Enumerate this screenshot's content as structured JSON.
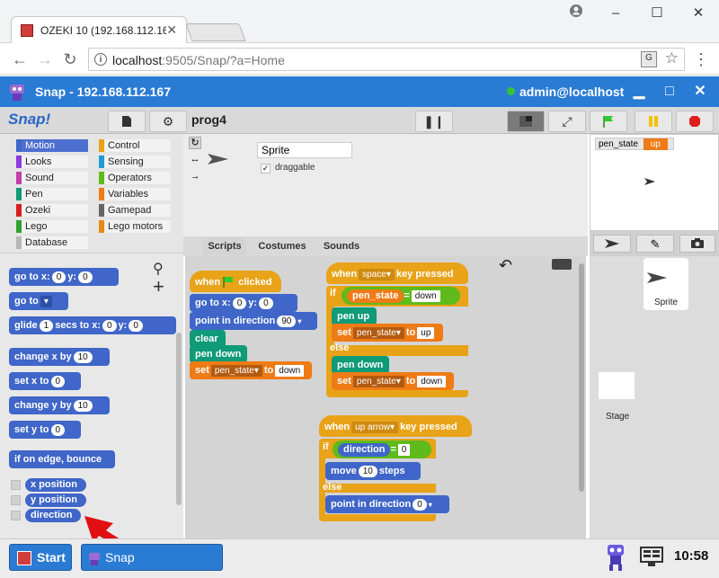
{
  "browser": {
    "tab_title": "OZEKI 10 (192.168.112.16",
    "url_host": "localhost",
    "url_rest": ":9505/Snap/?a=Home",
    "minimize": "–",
    "maximize": "☐",
    "close": "✕",
    "back": "←",
    "forward": "→",
    "reload": "↻"
  },
  "ozeki": {
    "title": "Snap - 192.168.112.167",
    "user": "admin@localhost",
    "minimize": "▁",
    "maximize": "□",
    "close": "✕"
  },
  "snap": {
    "logo": "Snap!",
    "project": "prog4",
    "categories": [
      {
        "label": "Motion",
        "color": "#3f66c8"
      },
      {
        "label": "Control",
        "color": "#e8a318"
      },
      {
        "label": "Looks",
        "color": "#8c3ce0"
      },
      {
        "label": "Sensing",
        "color": "#1f9ad6"
      },
      {
        "label": "Sound",
        "color": "#c43fa8"
      },
      {
        "label": "Operators",
        "color": "#5fbb1b"
      },
      {
        "label": "Pen",
        "color": "#0f9a78"
      },
      {
        "label": "Variables",
        "color": "#ef7b16"
      },
      {
        "label": "Ozeki",
        "color": "#d62020"
      },
      {
        "label": "Gamepad",
        "color": "#666666"
      },
      {
        "label": "Lego",
        "color": "#2fa22f"
      },
      {
        "label": "Lego motors",
        "color": "#e88a10"
      },
      {
        "label": "Database",
        "color": "#b8b8b8"
      }
    ],
    "palette": {
      "goto_xy": {
        "label": "go to x:",
        "x": "0",
        "y_label": "y:",
        "y": "0"
      },
      "goto": {
        "label": "go to"
      },
      "glide": {
        "label": "glide",
        "secs": "1",
        "secs_label": "secs to x:",
        "x": "0",
        "y_label": "y:",
        "y": "0"
      },
      "change_x": {
        "label": "change x by",
        "value": "10"
      },
      "set_x": {
        "label": "set x to",
        "value": "0"
      },
      "change_y": {
        "label": "change y by",
        "value": "10"
      },
      "set_y": {
        "label": "set y to",
        "value": "0"
      },
      "bounce": "if on edge, bounce",
      "x_position": "x position",
      "y_position": "y position",
      "direction": "direction"
    },
    "sprite": {
      "name": "Sprite",
      "draggable_label": "draggable"
    },
    "tabs": [
      "Scripts",
      "Costumes",
      "Sounds"
    ],
    "script1": {
      "hat": "when",
      "hat_suffix": "clicked",
      "goto_label": "go to x:",
      "goto_x": "0",
      "goto_y_label": "y:",
      "goto_y": "0",
      "point_label": "point in direction",
      "point_value": "90",
      "clear": "clear",
      "pen_down": "pen down",
      "set_label": "set",
      "set_var": "pen_state",
      "set_to": "to",
      "set_value": "down"
    },
    "script2": {
      "hat": "when",
      "key": "space",
      "hat_suffix": "key pressed",
      "if": "if",
      "var": "pen_state",
      "eq": "=",
      "cmp": "down",
      "pen_up": "pen up",
      "set_label": "set",
      "set_var": "pen_state",
      "set_to": "to",
      "set_value_1": "up",
      "else": "else",
      "pen_down": "pen down",
      "set_value_2": "down"
    },
    "script3": {
      "hat": "when",
      "key": "up arrow",
      "hat_suffix": "key pressed",
      "if": "if",
      "var": "direction",
      "eq": "=",
      "cmp": "0",
      "move_label": "move",
      "move_value": "10",
      "move_suffix": "steps",
      "else": "else",
      "point_label": "point in direction",
      "point_value": "0"
    },
    "stage_watcher": {
      "name": "pen_state",
      "value": "up"
    },
    "corral": {
      "sprite_label": "Sprite",
      "stage_label": "Stage"
    }
  },
  "taskbar": {
    "start": "Start",
    "app": "Snap",
    "time": "10:58"
  }
}
